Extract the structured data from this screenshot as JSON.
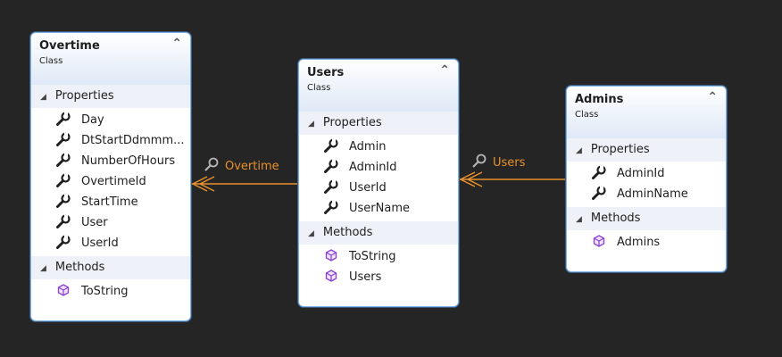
{
  "classes": [
    {
      "name": "Overtime",
      "kind": "Class",
      "properties_label": "Properties",
      "methods_label": "Methods",
      "properties": [
        "Day",
        "DtStartDdmmm...",
        "NumberOfHours",
        "OvertimeId",
        "StartTime",
        "User",
        "UserId"
      ],
      "methods": [
        "ToString"
      ]
    },
    {
      "name": "Users",
      "kind": "Class",
      "properties_label": "Properties",
      "methods_label": "Methods",
      "properties": [
        "Admin",
        "AdminId",
        "UserId",
        "UserName"
      ],
      "methods": [
        "ToString",
        "Users"
      ]
    },
    {
      "name": "Admins",
      "kind": "Class",
      "properties_label": "Properties",
      "methods_label": "Methods",
      "properties": [
        "AdminId",
        "AdminName"
      ],
      "methods": [
        "Admins"
      ]
    }
  ],
  "associations": [
    {
      "label": "Overtime",
      "icon": "wrench-icon"
    },
    {
      "label": "Users",
      "icon": "wrench-icon"
    }
  ],
  "colors": {
    "background": "#252526",
    "association": "#e8912d",
    "border": "#7eb4ea",
    "method_icon": "#8a3fd1"
  }
}
